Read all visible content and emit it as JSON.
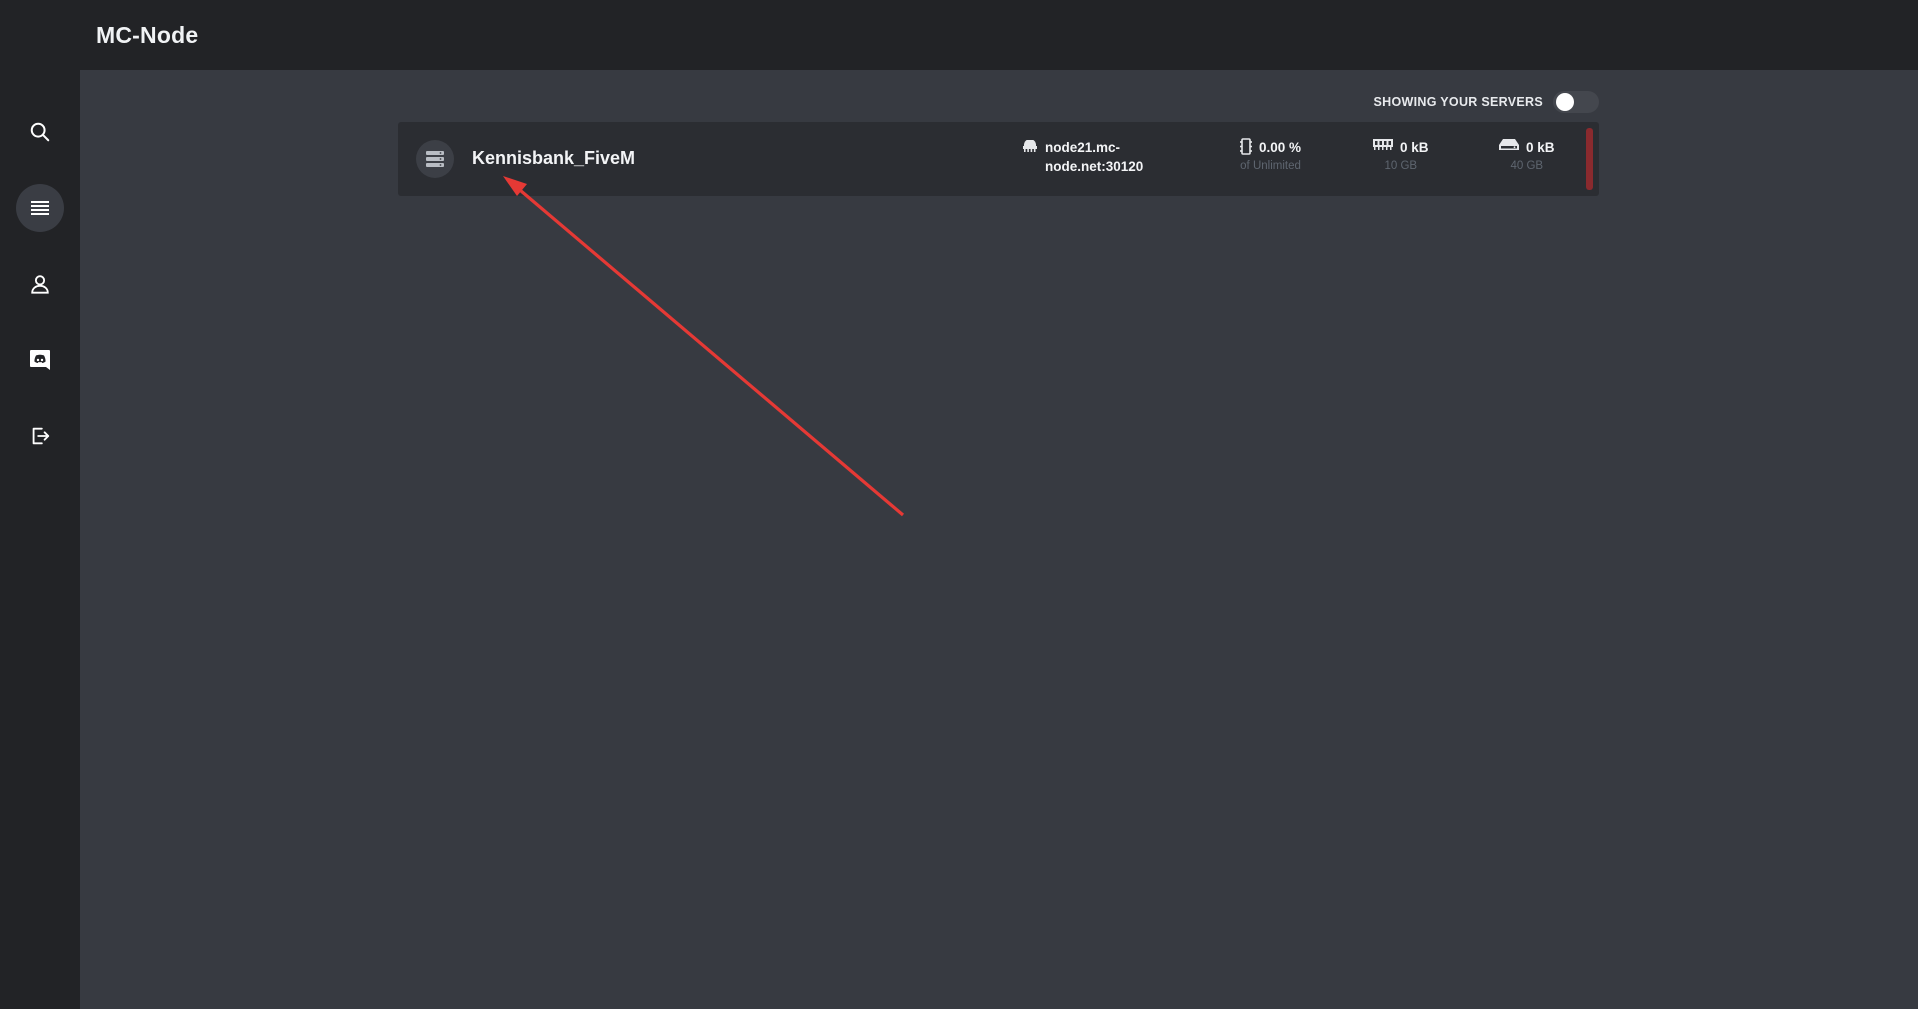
{
  "app": {
    "title": "MC-Node"
  },
  "sidebar": {
    "items": [
      {
        "icon": "search-icon"
      },
      {
        "icon": "server-list-icon",
        "active": true
      },
      {
        "icon": "account-icon"
      },
      {
        "icon": "discord-icon"
      },
      {
        "icon": "logout-icon"
      }
    ]
  },
  "toolbar": {
    "toggle_label": "SHOWING YOUR SERVERS",
    "toggle_on": false
  },
  "server": {
    "name": "Kennisbank_FiveM",
    "address_line1": "node21.mc-",
    "address_line2": "node.net:30120",
    "cpu_value": "0.00 %",
    "cpu_limit": "of Unlimited",
    "memory_value": "0 kB",
    "memory_limit": "10 GB",
    "disk_value": "0 kB",
    "disk_limit": "40 GB",
    "status_color": "#8a2a2e"
  },
  "colors": {
    "background": "#373a41",
    "bars": "#222326",
    "card": "#2b2d32",
    "annotation_arrow": "#e53935"
  }
}
